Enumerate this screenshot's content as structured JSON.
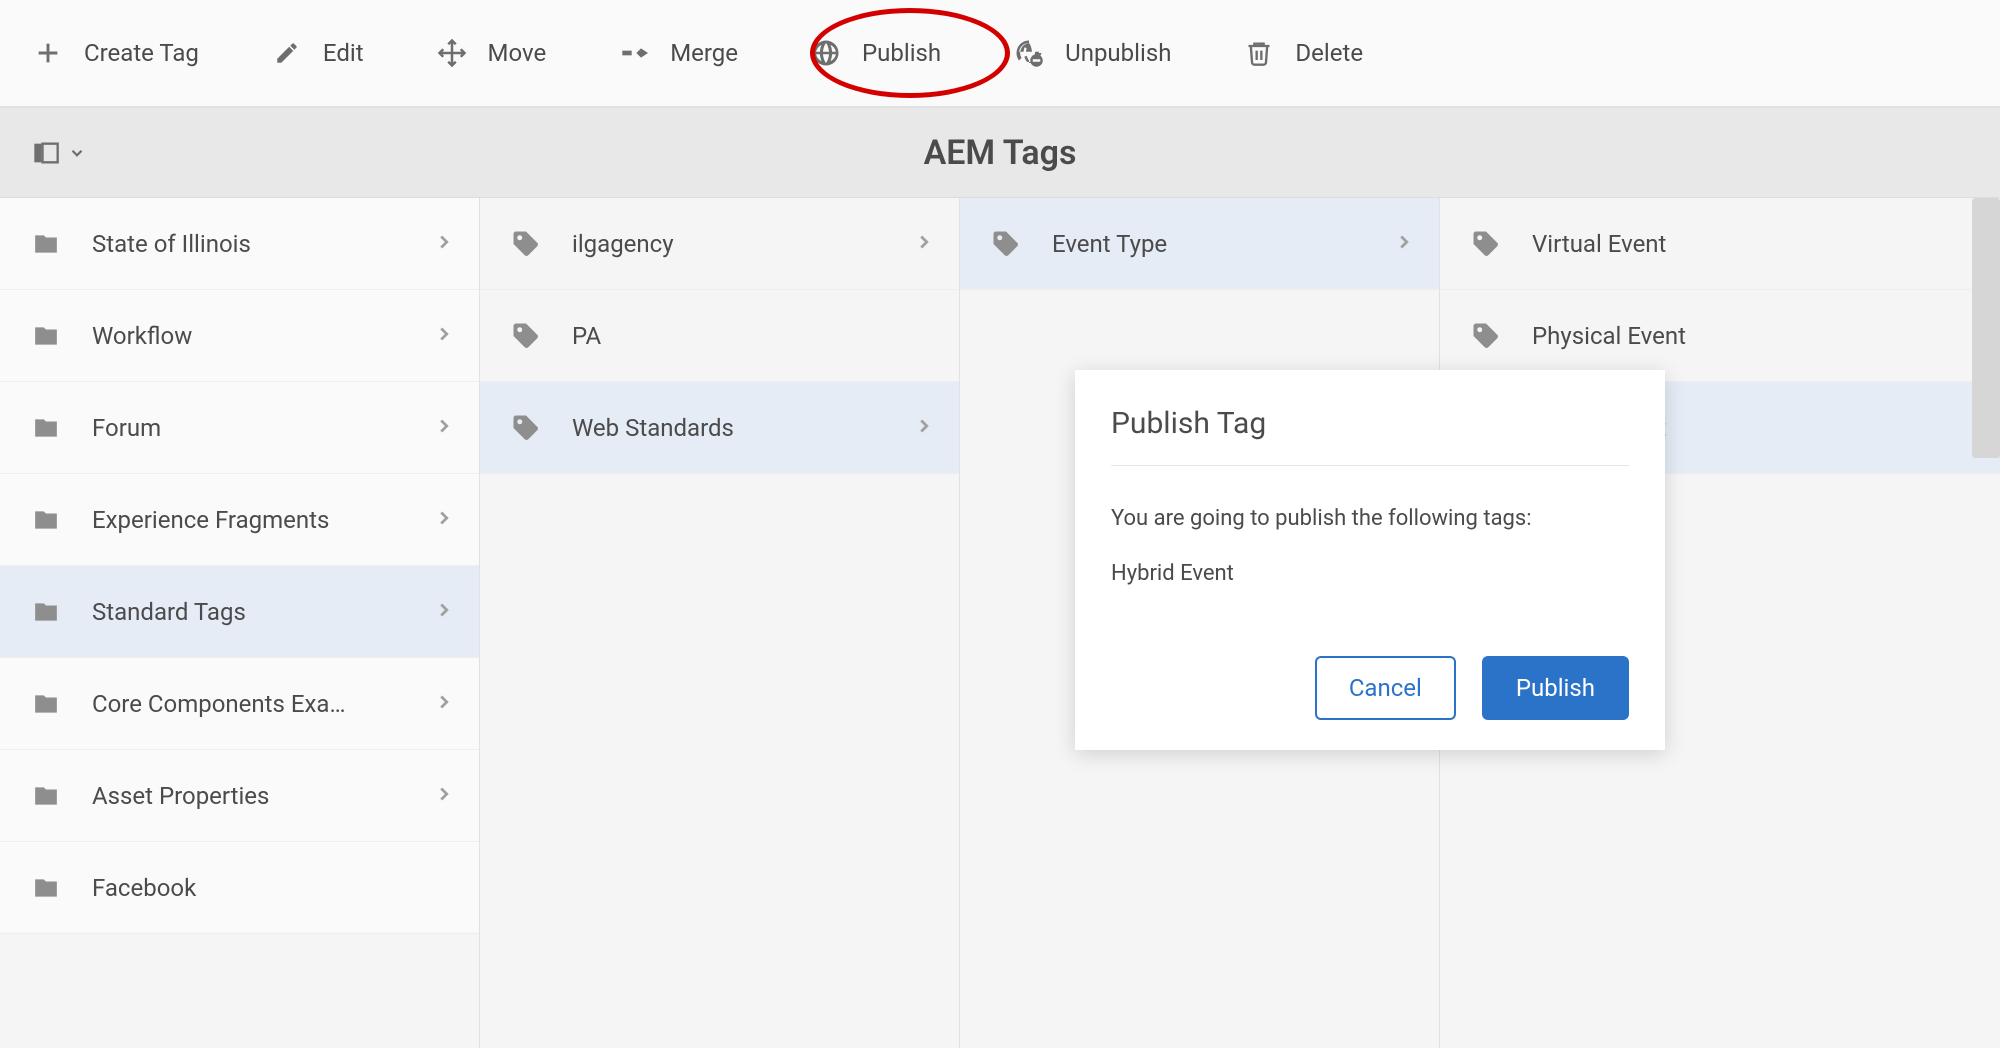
{
  "toolbar": {
    "create": "Create Tag",
    "edit": "Edit",
    "move": "Move",
    "merge": "Merge",
    "publish": "Publish",
    "unpublish": "Unpublish",
    "delete": "Delete"
  },
  "header": {
    "title": "AEM Tags"
  },
  "columns": [
    {
      "items": [
        {
          "label": "State of Illinois",
          "type": "folder",
          "hasChildren": true
        },
        {
          "label": "Workflow",
          "type": "folder",
          "hasChildren": true
        },
        {
          "label": "Forum",
          "type": "folder",
          "hasChildren": true
        },
        {
          "label": "Experience Fragments",
          "type": "folder",
          "hasChildren": true
        },
        {
          "label": "Standard Tags",
          "type": "folder",
          "hasChildren": true,
          "inPath": true
        },
        {
          "label": "Core Components Exa…",
          "type": "folder",
          "hasChildren": true
        },
        {
          "label": "Asset Properties",
          "type": "folder",
          "hasChildren": true
        },
        {
          "label": "Facebook",
          "type": "folder",
          "hasChildren": false
        }
      ]
    },
    {
      "items": [
        {
          "label": "ilgagency",
          "type": "tag",
          "hasChildren": true
        },
        {
          "label": "PA",
          "type": "tag",
          "hasChildren": false
        },
        {
          "label": "Web Standards",
          "type": "tag",
          "hasChildren": true,
          "inPath": true
        }
      ]
    },
    {
      "items": [
        {
          "label": "Event Type",
          "type": "tag",
          "hasChildren": true,
          "inPath": true
        }
      ]
    },
    {
      "items": [
        {
          "label": "Virtual Event",
          "type": "tag",
          "hasChildren": false
        },
        {
          "label": "Physical Event",
          "type": "tag",
          "hasChildren": false
        },
        {
          "label": "Hybrid Event",
          "type": "tag",
          "hasChildren": false,
          "selected": true
        }
      ]
    }
  ],
  "dialog": {
    "title": "Publish Tag",
    "message": "You are going to publish the following tags:",
    "tagName": "Hybrid Event",
    "cancel": "Cancel",
    "confirm": "Publish"
  },
  "annotation": {
    "highlight": "publish-button"
  }
}
